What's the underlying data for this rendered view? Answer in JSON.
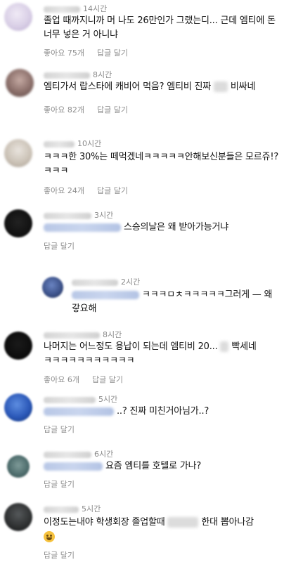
{
  "comments": [
    {
      "time": "14시간",
      "text": "졸업 때까지니까 머 나도 26만인가 그랬는디... 근데 엠티에 돈 너무 넣은 거 아니냐",
      "likes": "좋아요 75개",
      "reply": "답글 달기"
    },
    {
      "time": "8시간",
      "text_a": "엠티가서 랍스타에 캐비어 먹음? 엠티비 진짜",
      "text_b": "비싸네",
      "likes": "좋아요 82개",
      "reply": "답글 달기"
    },
    {
      "time": "10시간",
      "text": "ㅋㅋㅋ한 30%는 떼먹겠네ㅋㅋㅋㅋㅋ안해보신분들은 모르쥬!?ㅋㅋㅋ",
      "likes": "좋아요 24개",
      "reply": "답글 달기"
    },
    {
      "time": "3시간",
      "text": "스승의날은 왜 받아가능거냐",
      "reply": "답글 달기"
    },
    {
      "time": "2시간",
      "text": "ㅋㅋㅋㅁㅊㅋㅋㅋㅋㅋ그러게 — 왜갛요해"
    },
    {
      "time": "8시간",
      "text_a": "나머지는 어느정도 용납이 되는데 엠티비 20...",
      "text_b": "빡세네",
      "text_c": "ㅋㅋㅋㅋㅋㅋㅋㅋㅋㅋㅋ",
      "likes": "좋아요 6개",
      "reply": "답글 달기"
    },
    {
      "time": "5시간",
      "text": "..? 진짜 미친거아님가..?",
      "reply": "답글 달기"
    },
    {
      "time": "6시간",
      "text": "요즘 엠티를 호텔로 가나?",
      "reply": "답글 달기"
    },
    {
      "time": "5시간",
      "text_a": "이정도는내야 학생회장 졸업할때",
      "text_b": "한대 뽑아나감",
      "reply": "답글 달기"
    }
  ],
  "avatars": [
    "#d9cfe6",
    "#8b6f6a",
    "#c9c0b4",
    "#121212",
    "#3a4f86",
    "#0d0d0d",
    "#2b58b8",
    "#4c6b6b",
    "#2d2f30"
  ]
}
